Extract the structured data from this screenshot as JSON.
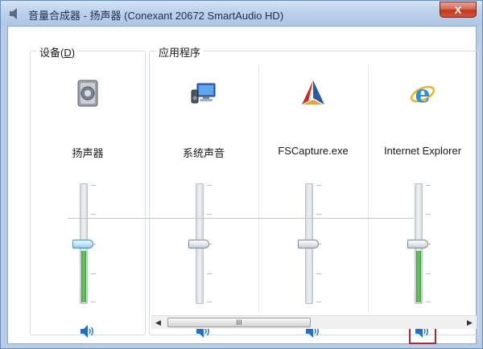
{
  "window": {
    "title": "音量合成器 - 扬声器 (Conexant 20672 SmartAudio HD)",
    "close_glyph": "X"
  },
  "device_group": {
    "label": "设备(D)",
    "label_plain": "设备(",
    "label_access": "D",
    "label_end": ")",
    "channel": {
      "name": "扬声器",
      "icon": "speaker-device-icon",
      "volume_percent": 43,
      "muted": false
    }
  },
  "app_group": {
    "label": "应用程序",
    "channels": [
      {
        "name": "系统声音",
        "icon": "system-sounds-icon",
        "volume_percent": 43
      },
      {
        "name": "FSCapture.exe",
        "icon": "fscapture-icon",
        "volume_percent": 43
      },
      {
        "name": "Internet Explorer",
        "icon": "internet-explorer-icon",
        "volume_percent": 43,
        "mute_highlighted": true
      }
    ]
  },
  "scrollbar": {
    "left_arrow": "◀",
    "right_arrow": "▶",
    "grip": "III"
  },
  "colors": {
    "accent_blue": "#1e6fc6",
    "level_green": "#4cb648",
    "highlight_red": "#b8252a"
  }
}
